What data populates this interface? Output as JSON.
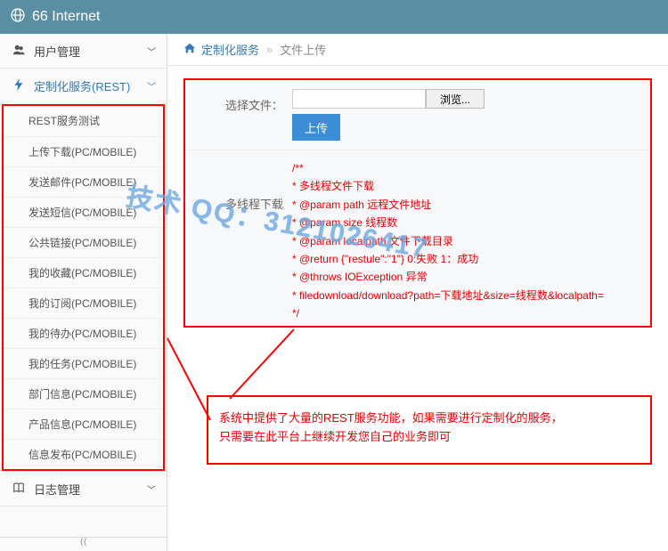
{
  "header": {
    "title": "66 Internet"
  },
  "nav": {
    "section_user": {
      "label": "用户管理",
      "expanded": false
    },
    "section_custom": {
      "label": "定制化服务(REST)",
      "expanded": true
    },
    "custom_items": [
      "REST服务测试",
      "上传下载(PC/MOBILE)",
      "发送邮件(PC/MOBILE)",
      "发送短信(PC/MOBILE)",
      "公共链接(PC/MOBILE)",
      "我的收藏(PC/MOBILE)",
      "我的订阅(PC/MOBILE)",
      "我的待办(PC/MOBILE)",
      "我的任务(PC/MOBILE)",
      "部门信息(PC/MOBILE)",
      "产品信息(PC/MOBILE)",
      "信息发布(PC/MOBILE)"
    ],
    "section_log": {
      "label": "日志管理",
      "expanded": false
    }
  },
  "breadcrumb": {
    "root": "定制化服务",
    "current": "文件上传"
  },
  "form": {
    "select_file_label": "选择文件：",
    "browse_label": "浏览...",
    "upload_label": "上传",
    "download_section_label": "多线程下载",
    "code_lines": [
      "/**",
      " * 多线程文件下载",
      " * @param path 远程文件地址",
      " * @param size 线程数",
      " * @param localpath 文件下载目录",
      " * @return {\"restule\":\"1\"} 0:失败 1：成功",
      " * @throws IOException 异常",
      " * filedownload/download?path=下载地址&size=线程数&localpath=",
      " */"
    ]
  },
  "note_box": {
    "line1": "系统中提供了大量的REST服务功能，如果需要进行定制化的服务，",
    "line2": "只需要在此平台上继续开发您自己的业务即可"
  },
  "watermark": "技术 QQ：3121026417"
}
